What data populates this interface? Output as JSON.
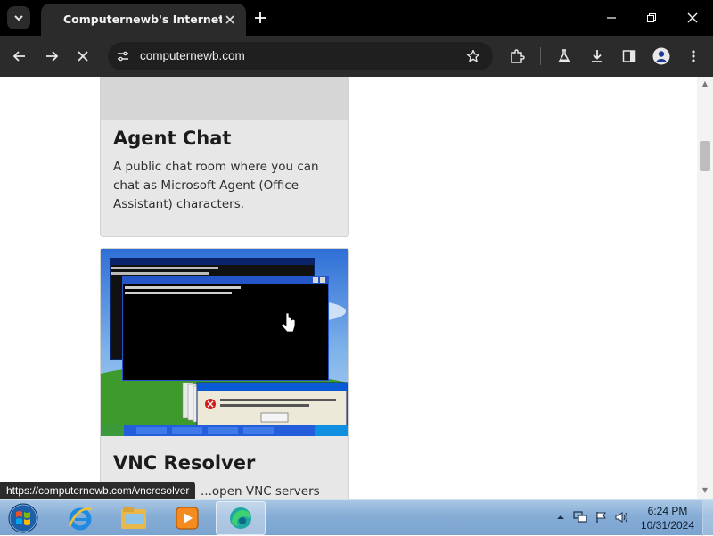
{
  "browser": {
    "tab_title": "Computernewb's Internet Pub",
    "url": "computernewb.com",
    "status_url": "https://computernewb.com/vncresolver"
  },
  "cards": [
    {
      "title": "Agent Chat",
      "description": "A public chat room where you can chat as Microsoft Agent (Office Assistant) characters."
    },
    {
      "title": "VNC Resolver",
      "description": "...open VNC servers that"
    }
  ],
  "taskbar": {
    "apps": [
      {
        "name": "internet-explorer"
      },
      {
        "name": "file-explorer"
      },
      {
        "name": "media-player"
      },
      {
        "name": "edge"
      }
    ],
    "clock_time": "6:24 PM",
    "clock_date": "10/31/2024"
  },
  "colors": {
    "tab_bar": "#000000",
    "toolbar": "#2b2b2b",
    "card_bg": "#e7e7e7",
    "taskbar": "#86add6"
  }
}
